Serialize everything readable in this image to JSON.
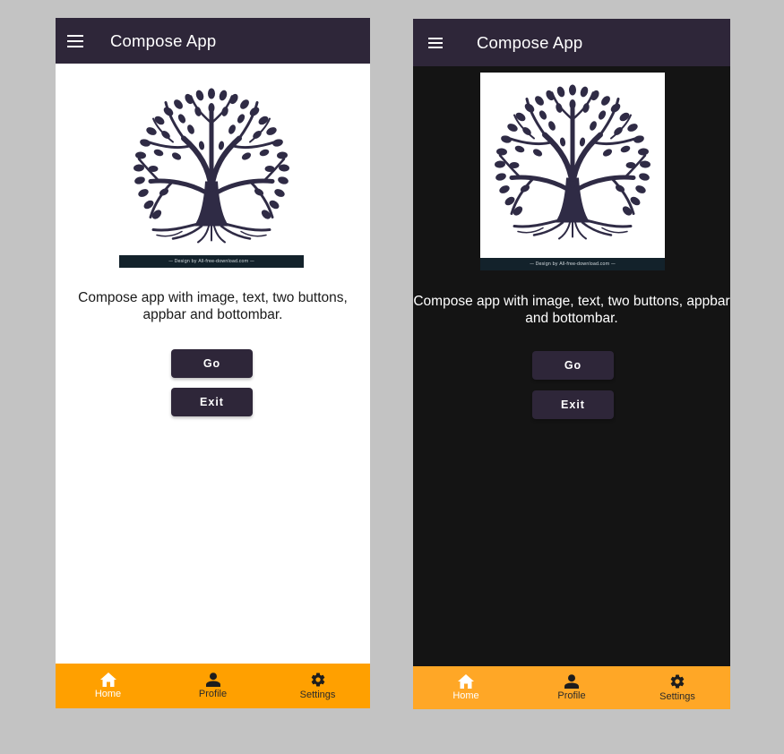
{
  "light": {
    "appbar": {
      "title": "Compose App",
      "menu_icon": "menu-icon"
    },
    "image": {
      "credit": "— Design by All-free-download.com —"
    },
    "description": "Compose app with image, text, two buttons, appbar and bottombar.",
    "buttons": {
      "go": "Go",
      "exit": "Exit"
    },
    "bottombar": {
      "items": [
        {
          "label": "Home",
          "icon": "home-icon",
          "selected": true
        },
        {
          "label": "Profile",
          "icon": "person-icon",
          "selected": false
        },
        {
          "label": "Settings",
          "icon": "gear-icon",
          "selected": false
        }
      ]
    }
  },
  "dark": {
    "appbar": {
      "title": "Compose App",
      "menu_icon": "menu-icon"
    },
    "image": {
      "credit": "— Design by All-free-download.com —"
    },
    "description": "Compose app with image, text, two buttons, appbar and bottombar.",
    "buttons": {
      "go": "Go",
      "exit": "Exit"
    },
    "bottombar": {
      "items": [
        {
          "label": "Home",
          "icon": "home-icon",
          "selected": true
        },
        {
          "label": "Profile",
          "icon": "person-icon",
          "selected": false
        },
        {
          "label": "Settings",
          "icon": "gear-icon",
          "selected": false
        }
      ]
    }
  },
  "colors": {
    "primary": "#2e2639",
    "light_background": "#ffffff",
    "dark_background": "#141414",
    "bottombar_light": "#ffa000",
    "bottombar_dark": "#ffa726",
    "outer_background": "#c3c3c3"
  }
}
